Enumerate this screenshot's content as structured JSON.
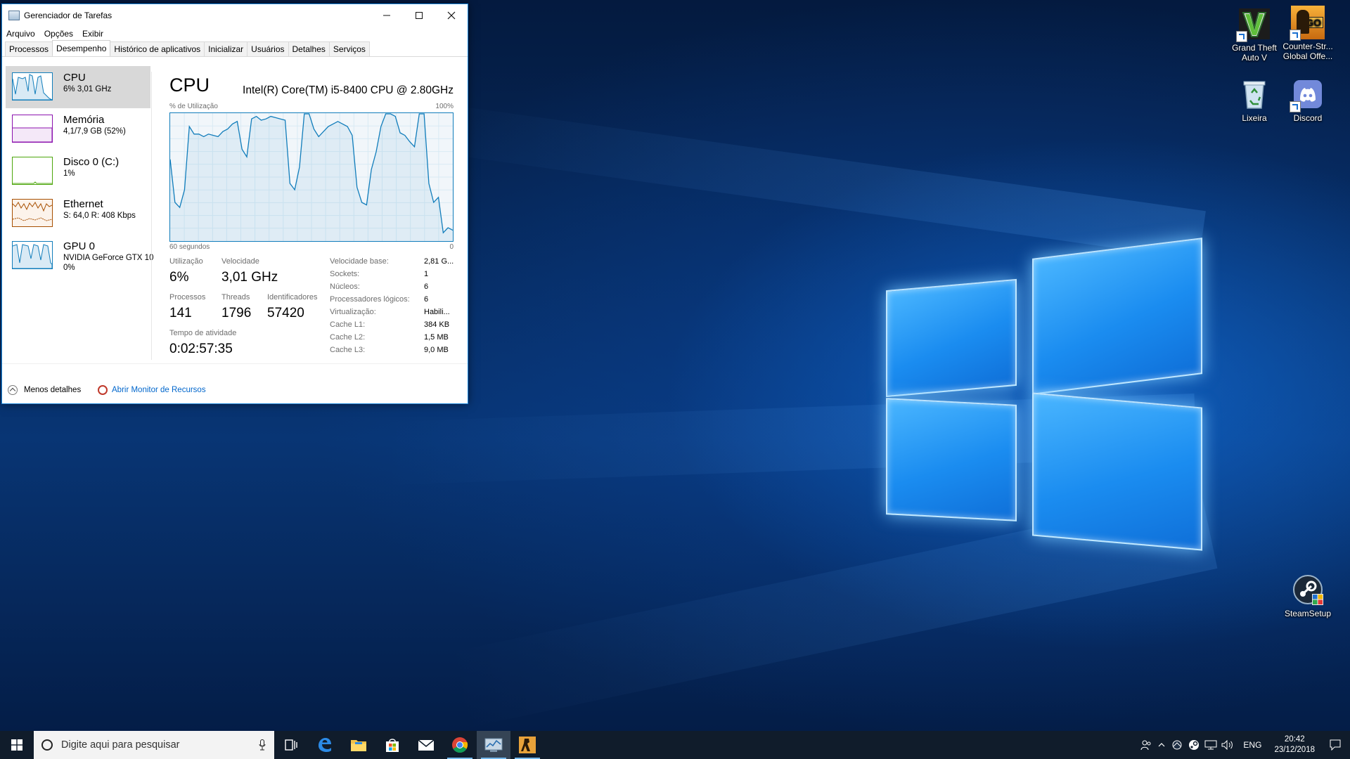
{
  "desktop": {
    "icons": [
      {
        "label_line1": "Grand Theft",
        "label_line2": "Auto V"
      },
      {
        "label_line1": "Counter-Str...",
        "label_line2": "Global Offe..."
      },
      {
        "label_line1": "Lixeira",
        "label_line2": ""
      },
      {
        "label_line1": "Discord",
        "label_line2": ""
      },
      {
        "label_line1": "SteamSetup",
        "label_line2": ""
      }
    ],
    "csgo_badge": "GO"
  },
  "taskmgr": {
    "title": "Gerenciador de Tarefas",
    "menu": [
      "Arquivo",
      "Opções",
      "Exibir"
    ],
    "tabs": [
      "Processos",
      "Desempenho",
      "Histórico de aplicativos",
      "Inicializar",
      "Usuários",
      "Detalhes",
      "Serviços"
    ],
    "active_tab": "Desempenho",
    "resources": [
      {
        "title": "CPU",
        "sub": "6% 3,01 GHz",
        "color": "#117dbb"
      },
      {
        "title": "Memória",
        "sub": "4,1/7,9 GB (52%)",
        "color": "#8b12ae"
      },
      {
        "title": "Disco 0 (C:)",
        "sub": "1%",
        "color": "#4da60c"
      },
      {
        "title": "Ethernet",
        "sub": "S: 64,0 R: 408 Kbps",
        "color": "#a74f01"
      },
      {
        "title": "GPU 0",
        "sub": "NVIDIA GeForce GTX 10",
        "sub2": "0%",
        "color": "#117dbb"
      }
    ],
    "cpu": {
      "heading": "CPU",
      "model": "Intel(R) Core(TM) i5-8400 CPU @ 2.80GHz",
      "graph_label": "% de Utilização",
      "graph_max": "100%",
      "graph_time": "60 segundos",
      "graph_zero": "0",
      "utilization_history": [
        64,
        30,
        26,
        40,
        90,
        84,
        84,
        82,
        84,
        83,
        82,
        86,
        88,
        92,
        94,
        72,
        66,
        96,
        98,
        95,
        96,
        98,
        97,
        96,
        95,
        45,
        40,
        58,
        100,
        100,
        88,
        82,
        86,
        90,
        92,
        94,
        92,
        90,
        83,
        42,
        30,
        28,
        56,
        70,
        90,
        100,
        100,
        98,
        85,
        83,
        78,
        74,
        100,
        100,
        45,
        30,
        34,
        6,
        10,
        8
      ],
      "stats": {
        "utilization_label": "Utilização",
        "utilization": "6%",
        "speed_label": "Velocidade",
        "speed": "3,01 GHz",
        "processes_label": "Processos",
        "processes": "141",
        "threads_label": "Threads",
        "threads": "1796",
        "handles_label": "Identificadores",
        "handles": "57420",
        "uptime_label": "Tempo de atividade",
        "uptime": "0:02:57:35"
      },
      "specs": [
        {
          "label": "Velocidade base:",
          "value": "2,81 G..."
        },
        {
          "label": "Sockets:",
          "value": "1"
        },
        {
          "label": "Núcleos:",
          "value": "6"
        },
        {
          "label": "Processadores lógicos:",
          "value": "6"
        },
        {
          "label": "Virtualização:",
          "value": "Habili..."
        },
        {
          "label": "Cache L1:",
          "value": "384 KB"
        },
        {
          "label": "Cache L2:",
          "value": "1,5 MB"
        },
        {
          "label": "Cache L3:",
          "value": "9,0 MB"
        }
      ]
    },
    "footer": {
      "fewer": "Menos detalhes",
      "resmon": "Abrir Monitor de Recursos"
    }
  },
  "taskbar": {
    "search_placeholder": "Digite aqui para pesquisar",
    "language": "ENG",
    "time": "20:42",
    "date": "23/12/2018"
  }
}
